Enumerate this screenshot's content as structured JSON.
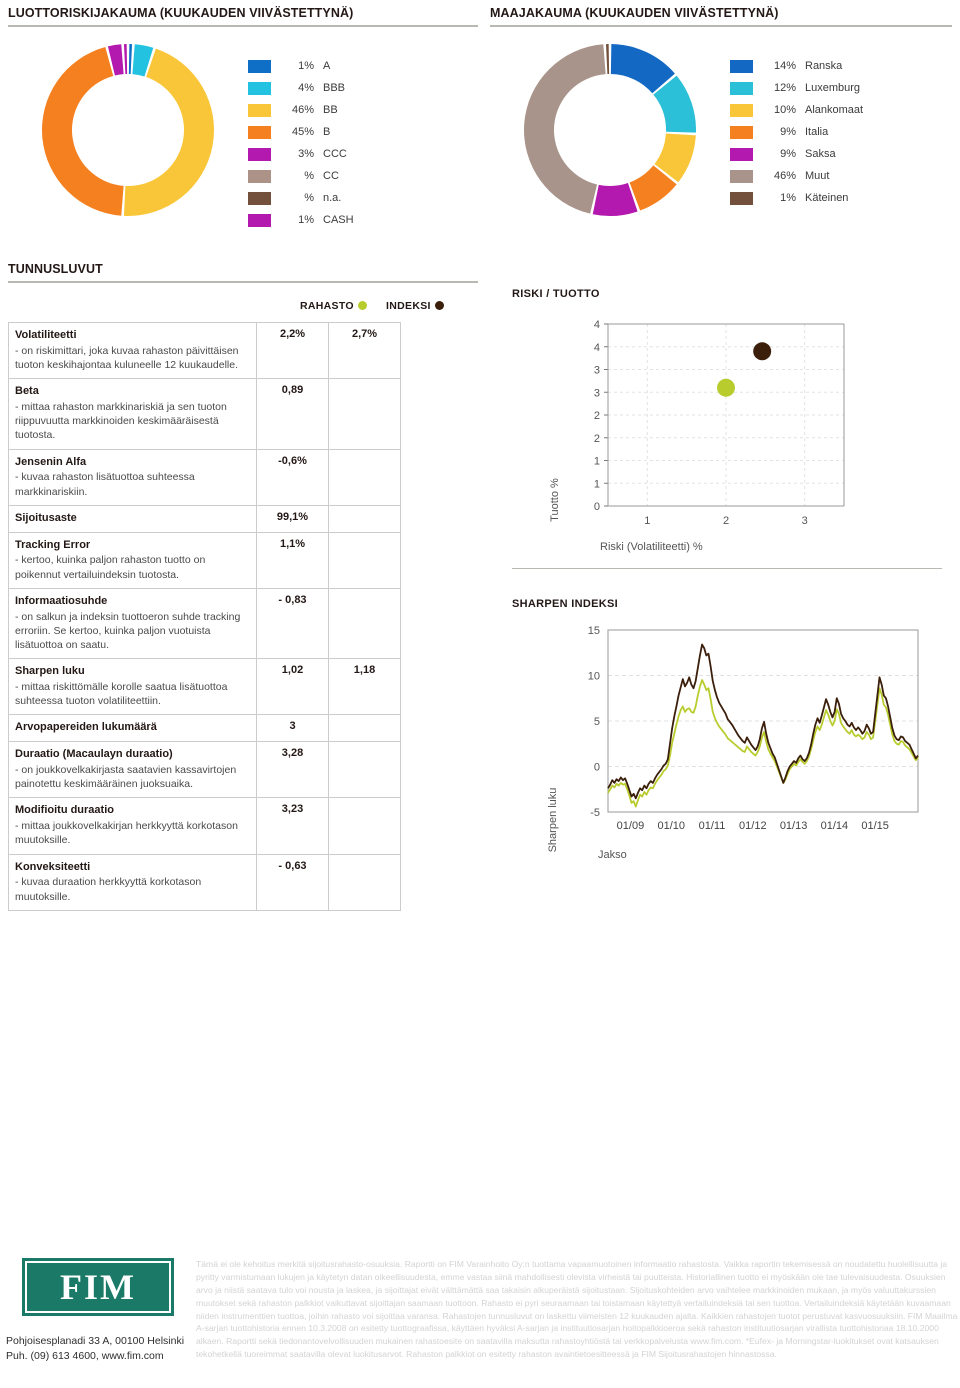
{
  "credit_section": {
    "title": "LUOTTORISKIJAKAUMA (KUUKAUDEN VIIVÄSTETTYNÄ)"
  },
  "country_section": {
    "title": "MAAJAKAUMA (KUUKAUDEN VIIVÄSTETTYNÄ)"
  },
  "kpi_section": {
    "title": "TUNNUSLUVUT",
    "col_fund": "RAHASTO",
    "col_index": "INDEKSI",
    "fund_color": "#b9cc2e",
    "index_color": "#3b1f0b",
    "rows": [
      {
        "name": "Volatiliteetti",
        "desc": "- on riskimittari, joka kuvaa rahaston päivittäisen tuoton keskihajontaa kuluneelle 12 kuukaudelle.",
        "fund": "2,2%",
        "index": "2,7%"
      },
      {
        "name": "Beta",
        "desc": "- mittaa rahaston markkinariskiä ja sen tuoton riippuvuutta markkinoiden keskimääräisestä tuotosta.",
        "fund": "0,89",
        "index": ""
      },
      {
        "name": "Jensenin Alfa",
        "desc": "- kuvaa rahaston lisätuottoa suhteessa markkinariskiin.",
        "fund": "-0,6%",
        "index": ""
      },
      {
        "name": "Sijoitusaste",
        "desc": "",
        "fund": "99,1%",
        "index": ""
      },
      {
        "name": "Tracking Error",
        "desc": "- kertoo, kuinka paljon rahaston tuotto on poikennut vertailuindeksin tuotosta.",
        "fund": "1,1%",
        "index": ""
      },
      {
        "name": "Informaatiosuhde",
        "desc": "- on salkun ja indeksin tuottoeron suhde tracking erroriin. Se kertoo, kuinka paljon vuotuista lisätuottoa on saatu.",
        "fund": "- 0,83",
        "index": ""
      },
      {
        "name": "Sharpen luku",
        "desc": "- mittaa riskittömälle korolle saatua lisätuottoa suhteessa tuoton volatiliteettiin.",
        "fund": "1,02",
        "index": "1,18"
      },
      {
        "name": "Arvopapereiden lukumäärä",
        "desc": "",
        "fund": "3",
        "index": ""
      },
      {
        "name": "Duraatio (Macaulayn duraatio)",
        "desc": "- on joukkovelkakirjasta saatavien kassavirtojen painotettu keskimääräinen juoksuaika.",
        "fund": "3,28",
        "index": ""
      },
      {
        "name": "Modifioitu duraatio",
        "desc": "- mittaa joukkovelkakirjan herkkyyttä korkotason muutoksille.",
        "fund": "3,23",
        "index": ""
      },
      {
        "name": "Konveksiteetti",
        "desc": "- kuvaa duraation herkkyyttä korkotason muutoksille.",
        "fund": "- 0,63",
        "index": ""
      }
    ]
  },
  "risk_return_section": {
    "title": "RISKI / TUOTTO"
  },
  "sharpe_section": {
    "title": "SHARPEN INDEKSI"
  },
  "footer": {
    "logo_text": "FIM",
    "address_line1": "Pohjoisesplanadi 33 A, 00100 Helsinki",
    "address_line2": "Puh. (09) 613 4600, www.fim.com",
    "disclaimer": "Tämä ei ole kehoitus merkitä sijoitusrahasto-osuuksia. Raportti on FIM Varainhoito Oy:n tuottama vapaamuotoinen informaatio rahastosta. Vaikka raportin tekemisessä on noudatettu huolellisuutta ja pyritty varmistumaan lukujen ja käytetyn datan oikeellisuudesta, emme vastaa siinä mahdollisesti olevista virheistä tai puutteista. Historiallinen tuotto ei myöskään ole tae tulevaisuudesta. Osuuksien arvo ja niistä saatava tulo voi nousta ja laskea, ja sijoittajat eivät välttämättä saa takaisin alkuperäistä sijoitustaan. Sijoituskohteiden arvo vaihtelee markkinoiden mukaan, ja myös valuuttakurssien muutokset sekä rahaston palkkiot vaikuttavat sijoittajan saamaan tuottoon. Rahasto ei pyri seuraamaan tai toistamaan käytettyä vertailuindeksiä tai sen tuottoa. Vertailuindeksiä käytetään kuvaamaan niiden instrumenttien tuottoa, joihin rahasto voi sijoittaa varansa. Rahastojen tunnusluvut on laskettu viimeisten 12 kuukauden ajalta. Kaikkien rahastojen tuotot perustuvat kasvuosuuksiin. FIM Maailma A-sarjan tuottohistoria ennen 10.3.2008 on esitetty tuottograafissa, käyttäen hyväksi A-sarjan ja instituutiosarjan hoitopalkkioeroa sekä rahaston instituutiosarjan virallista tuottohistoriaa 18.10.2000 alkaen. Raportti sekä tiedonantovelvollisuuden mukainen rahastoesite on saatavilla maksutta rahastoyhtiöstä tai verkkopalvelusta www.fim.com. *Eufex- ja Morningstar-luokitukset ovat katsauksen tekohetkellä tuoreimmat saatavilla olevat luokitusarvot. Rahaston palkkiot on esitetty rahaston avaintietoesitteessä ja FIM Sijoitusrahastojen hinnastossa."
  },
  "chart_data": [
    {
      "type": "pie",
      "id": "credit-donut",
      "title": "LUOTTORISKIJAKAUMA (KUUKAUDEN VIIVÄSTETTYNÄ)",
      "legend_position": "right",
      "labels": [
        "A",
        "BBB",
        "BB",
        "B",
        "CCC",
        "CC",
        "n.a.",
        "CASH"
      ],
      "pct_labels": [
        "1%",
        "4%",
        "46%",
        "45%",
        "3%",
        "%",
        "%",
        "1%"
      ],
      "values": [
        1,
        4,
        46,
        45,
        3,
        0,
        0,
        1
      ],
      "colors": [
        "#0f6fc6",
        "#22c2e0",
        "#fac639",
        "#f5801f",
        "#b319ae",
        "#ad9287",
        "#73503c",
        "#b319ae"
      ]
    },
    {
      "type": "pie",
      "id": "country-donut",
      "title": "MAAJAKAUMA (KUUKAUDEN VIIVÄSTETTYNÄ)",
      "legend_position": "right",
      "labels": [
        "Ranska",
        "Luxemburg",
        "Alankomaat",
        "Italia",
        "Saksa",
        "Muut",
        "Käteinen"
      ],
      "pct_labels": [
        "14%",
        "12%",
        "10%",
        "9%",
        "9%",
        "46%",
        "1%"
      ],
      "values": [
        14,
        12,
        10,
        9,
        9,
        46,
        1
      ],
      "colors": [
        "#1268c3",
        "#2bc0d8",
        "#fac639",
        "#f5801f",
        "#b319ae",
        "#a8948a",
        "#73503c"
      ]
    },
    {
      "type": "scatter",
      "id": "risk-return",
      "title": "RISKI / TUOTTO",
      "xlabel": "Riski (Volatiliteetti) %",
      "ylabel": "Tuotto %",
      "xlim": [
        0.5,
        3.5
      ],
      "ylim": [
        0,
        4
      ],
      "xticks": [
        1,
        2,
        3
      ],
      "xtick_labels": [
        "1",
        "2",
        "3"
      ],
      "yticks": [
        0,
        0.5,
        1,
        1.5,
        2,
        2.5,
        3,
        3.5,
        4
      ],
      "ytick_labels": [
        "0",
        "1",
        "1",
        "2",
        "2",
        "3",
        "3",
        "4"
      ],
      "grid": true,
      "points": [
        {
          "name": "RAHASTO",
          "x": 2.0,
          "y": 2.6,
          "color": "#b9cc2e"
        },
        {
          "name": "INDEKSI",
          "x": 2.46,
          "y": 3.4,
          "color": "#3b1f0b"
        }
      ]
    },
    {
      "type": "line",
      "id": "sharpe-index",
      "title": "SHARPEN INDEKSI",
      "xlabel": "Jakso",
      "ylabel": "Sharpen luku",
      "ylim": [
        -5,
        15
      ],
      "yticks": [
        -5,
        0,
        5,
        10,
        15
      ],
      "ytick_labels": [
        "-5",
        "0",
        "5",
        "10",
        "15"
      ],
      "xtick_labels": [
        "01/09",
        "01/10",
        "01/11",
        "01/12",
        "01/13",
        "01/14",
        "01/15"
      ],
      "grid": true,
      "series": [
        {
          "name": "INDEKSI",
          "color": "#3b1f0b",
          "values": [
            -2.4,
            -2.0,
            -1.5,
            -1.8,
            -1.4,
            -1.6,
            -1.2,
            -1.5,
            -1.3,
            -1.9,
            -2.6,
            -3.3,
            -3.0,
            -3.5,
            -2.9,
            -2.4,
            -2.6,
            -2.1,
            -2.4,
            -1.9,
            -1.6,
            -1.8,
            -1.3,
            -0.9,
            -0.6,
            -0.3,
            0.1,
            0.3,
            0.8,
            2.5,
            4.2,
            5.5,
            6.6,
            7.8,
            8.7,
            9.6,
            8.8,
            9.2,
            9.8,
            9.0,
            8.6,
            9.4,
            10.8,
            12.2,
            13.4,
            13.0,
            12.2,
            12.4,
            11.0,
            9.4,
            8.4,
            7.6,
            7.0,
            6.6,
            6.2,
            5.8,
            5.2,
            4.9,
            4.6,
            4.2,
            3.8,
            3.4,
            3.1,
            2.8,
            2.6,
            3.2,
            2.8,
            2.4,
            2.1,
            1.8,
            2.2,
            3.0,
            4.2,
            4.9,
            3.6,
            2.6,
            2.0,
            1.4,
            1.0,
            0.3,
            -0.4,
            -1.1,
            -1.8,
            -1.2,
            -0.5,
            0.0,
            0.3,
            0.6,
            0.4,
            0.9,
            1.2,
            0.8,
            0.6,
            0.9,
            1.5,
            2.4,
            3.6,
            4.6,
            5.3,
            4.8,
            5.6,
            6.5,
            7.4,
            6.8,
            6.0,
            5.4,
            6.0,
            7.5,
            6.9,
            5.8,
            5.3,
            5.0,
            4.6,
            4.4,
            4.8,
            4.3,
            4.0,
            4.3,
            4.0,
            3.6,
            3.9,
            4.6,
            4.2,
            3.6,
            3.8,
            5.8,
            7.8,
            9.8,
            9.0,
            7.8,
            7.5,
            6.6,
            5.4,
            4.2,
            3.4,
            3.0,
            2.9,
            3.3,
            3.2,
            2.8,
            2.6,
            2.4,
            1.9,
            1.4,
            0.9,
            1.2
          ]
        },
        {
          "name": "RAHASTO",
          "color": "#b9cc2e",
          "values": [
            -2.9,
            -2.5,
            -2.1,
            -2.3,
            -1.9,
            -2.1,
            -1.8,
            -2.0,
            -1.9,
            -2.5,
            -3.2,
            -4.0,
            -3.8,
            -4.4,
            -3.7,
            -3.1,
            -3.3,
            -2.8,
            -3.1,
            -2.6,
            -2.3,
            -2.4,
            -1.9,
            -1.5,
            -1.2,
            -0.9,
            -0.5,
            -0.3,
            0.1,
            1.2,
            2.6,
            3.6,
            4.6,
            5.5,
            6.2,
            6.6,
            6.0,
            6.3,
            6.4,
            6.0,
            5.9,
            6.6,
            7.8,
            8.8,
            9.5,
            9.0,
            8.4,
            8.6,
            7.4,
            6.0,
            5.3,
            4.8,
            4.4,
            4.1,
            3.8,
            3.5,
            3.1,
            2.9,
            2.7,
            2.5,
            2.3,
            2.1,
            1.9,
            1.7,
            1.6,
            2.2,
            1.9,
            1.6,
            1.4,
            1.2,
            1.6,
            2.2,
            3.2,
            3.8,
            2.7,
            1.9,
            1.4,
            1.0,
            0.6,
            0.0,
            -0.6,
            -1.2,
            -1.8,
            -1.4,
            -0.8,
            -0.3,
            0.0,
            0.3,
            0.1,
            0.5,
            0.8,
            0.5,
            0.3,
            0.6,
            1.1,
            1.9,
            2.9,
            3.8,
            4.4,
            4.0,
            4.6,
            5.4,
            6.2,
            5.7,
            5.0,
            4.5,
            5.0,
            6.3,
            5.8,
            4.8,
            4.4,
            4.1,
            3.8,
            3.6,
            4.0,
            3.5,
            3.3,
            3.5,
            3.3,
            3.0,
            3.2,
            3.8,
            3.5,
            3.0,
            3.2,
            5.0,
            6.8,
            8.6,
            7.9,
            6.8,
            6.5,
            5.7,
            4.6,
            3.5,
            2.8,
            2.5,
            2.4,
            2.8,
            2.7,
            2.3,
            2.1,
            1.9,
            1.5,
            1.1,
            0.7,
            1.0
          ]
        }
      ]
    }
  ]
}
